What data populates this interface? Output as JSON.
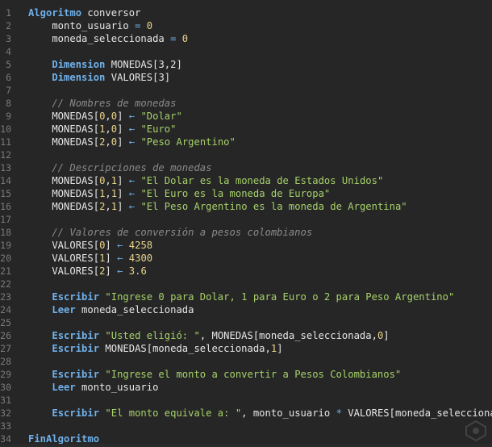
{
  "editor": {
    "lines": [
      {
        "n": "1",
        "tokens": [
          {
            "t": "Algoritmo",
            "c": "kw"
          },
          {
            "t": " conversor",
            "c": "id"
          }
        ]
      },
      {
        "n": "2",
        "tokens": [
          {
            "t": "    monto_usuario ",
            "c": "id"
          },
          {
            "t": "=",
            "c": "op"
          },
          {
            "t": " 0",
            "c": "num"
          }
        ]
      },
      {
        "n": "3",
        "tokens": [
          {
            "t": "    moneda_seleccionada ",
            "c": "id"
          },
          {
            "t": "=",
            "c": "op"
          },
          {
            "t": " 0",
            "c": "num"
          }
        ]
      },
      {
        "n": "4",
        "tokens": []
      },
      {
        "n": "5",
        "tokens": [
          {
            "t": "    ",
            "c": "id"
          },
          {
            "t": "Dimension",
            "c": "kw"
          },
          {
            "t": " MONEDAS[3,2]",
            "c": "id"
          }
        ]
      },
      {
        "n": "6",
        "tokens": [
          {
            "t": "    ",
            "c": "id"
          },
          {
            "t": "Dimension",
            "c": "kw"
          },
          {
            "t": " VALORES[3]",
            "c": "id"
          }
        ]
      },
      {
        "n": "7",
        "tokens": []
      },
      {
        "n": "8",
        "tokens": [
          {
            "t": "    // Nombres de monedas",
            "c": "cm"
          }
        ]
      },
      {
        "n": "9",
        "tokens": [
          {
            "t": "    MONEDAS[",
            "c": "id"
          },
          {
            "t": "0",
            "c": "num"
          },
          {
            "t": ",",
            "c": "id"
          },
          {
            "t": "0",
            "c": "num"
          },
          {
            "t": "] ",
            "c": "id"
          },
          {
            "t": "←",
            "c": "op"
          },
          {
            "t": " \"Dolar\"",
            "c": "str"
          }
        ]
      },
      {
        "n": "10",
        "tokens": [
          {
            "t": "    MONEDAS[",
            "c": "id"
          },
          {
            "t": "1",
            "c": "num"
          },
          {
            "t": ",",
            "c": "id"
          },
          {
            "t": "0",
            "c": "num"
          },
          {
            "t": "] ",
            "c": "id"
          },
          {
            "t": "←",
            "c": "op"
          },
          {
            "t": " \"Euro\"",
            "c": "str"
          }
        ]
      },
      {
        "n": "11",
        "tokens": [
          {
            "t": "    MONEDAS[",
            "c": "id"
          },
          {
            "t": "2",
            "c": "num"
          },
          {
            "t": ",",
            "c": "id"
          },
          {
            "t": "0",
            "c": "num"
          },
          {
            "t": "] ",
            "c": "id"
          },
          {
            "t": "←",
            "c": "op"
          },
          {
            "t": " \"Peso Argentino\"",
            "c": "str"
          }
        ]
      },
      {
        "n": "12",
        "tokens": []
      },
      {
        "n": "13",
        "tokens": [
          {
            "t": "    // Descripciones de monedas",
            "c": "cm"
          }
        ]
      },
      {
        "n": "14",
        "tokens": [
          {
            "t": "    MONEDAS[",
            "c": "id"
          },
          {
            "t": "0",
            "c": "num"
          },
          {
            "t": ",",
            "c": "id"
          },
          {
            "t": "1",
            "c": "num"
          },
          {
            "t": "] ",
            "c": "id"
          },
          {
            "t": "←",
            "c": "op"
          },
          {
            "t": " \"El Dolar es la moneda de Estados Unidos\"",
            "c": "str"
          }
        ]
      },
      {
        "n": "15",
        "tokens": [
          {
            "t": "    MONEDAS[",
            "c": "id"
          },
          {
            "t": "1",
            "c": "num"
          },
          {
            "t": ",",
            "c": "id"
          },
          {
            "t": "1",
            "c": "num"
          },
          {
            "t": "] ",
            "c": "id"
          },
          {
            "t": "←",
            "c": "op"
          },
          {
            "t": " \"El Euro es la moneda de Europa\"",
            "c": "str"
          }
        ]
      },
      {
        "n": "16",
        "tokens": [
          {
            "t": "    MONEDAS[",
            "c": "id"
          },
          {
            "t": "2",
            "c": "num"
          },
          {
            "t": ",",
            "c": "id"
          },
          {
            "t": "1",
            "c": "num"
          },
          {
            "t": "] ",
            "c": "id"
          },
          {
            "t": "←",
            "c": "op"
          },
          {
            "t": " \"El Peso Argentino es la moneda de Argentina\"",
            "c": "str"
          }
        ]
      },
      {
        "n": "17",
        "tokens": []
      },
      {
        "n": "18",
        "tokens": [
          {
            "t": "    // Valores de conversión a pesos colombianos",
            "c": "cm"
          }
        ]
      },
      {
        "n": "19",
        "tokens": [
          {
            "t": "    VALORES[",
            "c": "id"
          },
          {
            "t": "0",
            "c": "num"
          },
          {
            "t": "] ",
            "c": "id"
          },
          {
            "t": "←",
            "c": "op"
          },
          {
            "t": " 4258",
            "c": "num"
          }
        ]
      },
      {
        "n": "20",
        "tokens": [
          {
            "t": "    VALORES[",
            "c": "id"
          },
          {
            "t": "1",
            "c": "num"
          },
          {
            "t": "] ",
            "c": "id"
          },
          {
            "t": "←",
            "c": "op"
          },
          {
            "t": " 4300",
            "c": "num"
          }
        ]
      },
      {
        "n": "21",
        "tokens": [
          {
            "t": "    VALORES[",
            "c": "id"
          },
          {
            "t": "2",
            "c": "num"
          },
          {
            "t": "] ",
            "c": "id"
          },
          {
            "t": "←",
            "c": "op"
          },
          {
            "t": " 3.6",
            "c": "num"
          }
        ]
      },
      {
        "n": "22",
        "tokens": []
      },
      {
        "n": "23",
        "tokens": [
          {
            "t": "    ",
            "c": "id"
          },
          {
            "t": "Escribir",
            "c": "kw"
          },
          {
            "t": " \"Ingrese 0 para Dolar, 1 para Euro o 2 para Peso Argentino\"",
            "c": "str"
          }
        ]
      },
      {
        "n": "24",
        "tokens": [
          {
            "t": "    ",
            "c": "id"
          },
          {
            "t": "Leer",
            "c": "kw"
          },
          {
            "t": " moneda_seleccionada",
            "c": "id"
          }
        ]
      },
      {
        "n": "25",
        "tokens": []
      },
      {
        "n": "26",
        "tokens": [
          {
            "t": "    ",
            "c": "id"
          },
          {
            "t": "Escribir",
            "c": "kw"
          },
          {
            "t": " \"Usted eligió: \"",
            "c": "str"
          },
          {
            "t": ", MONEDAS[moneda_seleccionada,",
            "c": "id"
          },
          {
            "t": "0",
            "c": "num"
          },
          {
            "t": "]",
            "c": "id"
          }
        ]
      },
      {
        "n": "27",
        "tokens": [
          {
            "t": "    ",
            "c": "id"
          },
          {
            "t": "Escribir",
            "c": "kw"
          },
          {
            "t": " MONEDAS[moneda_seleccionada,",
            "c": "id"
          },
          {
            "t": "1",
            "c": "num"
          },
          {
            "t": "]",
            "c": "id"
          }
        ]
      },
      {
        "n": "28",
        "tokens": []
      },
      {
        "n": "29",
        "tokens": [
          {
            "t": "    ",
            "c": "id"
          },
          {
            "t": "Escribir",
            "c": "kw"
          },
          {
            "t": " \"Ingrese el monto a convertir a Pesos Colombianos\"",
            "c": "str"
          }
        ]
      },
      {
        "n": "30",
        "tokens": [
          {
            "t": "    ",
            "c": "id"
          },
          {
            "t": "Leer",
            "c": "kw"
          },
          {
            "t": " monto_usuario",
            "c": "id"
          }
        ]
      },
      {
        "n": "31",
        "tokens": []
      },
      {
        "n": "32",
        "tokens": [
          {
            "t": "    ",
            "c": "id"
          },
          {
            "t": "Escribir",
            "c": "kw"
          },
          {
            "t": " \"El monto equivale a: \"",
            "c": "str"
          },
          {
            "t": ", monto_usuario ",
            "c": "id"
          },
          {
            "t": "*",
            "c": "op"
          },
          {
            "t": " VALORES[moneda_seleccionada]",
            "c": "id"
          }
        ]
      },
      {
        "n": "33",
        "tokens": []
      },
      {
        "n": "34",
        "tokens": [
          {
            "t": "FinAlgoritmo",
            "c": "kw"
          }
        ]
      }
    ]
  }
}
